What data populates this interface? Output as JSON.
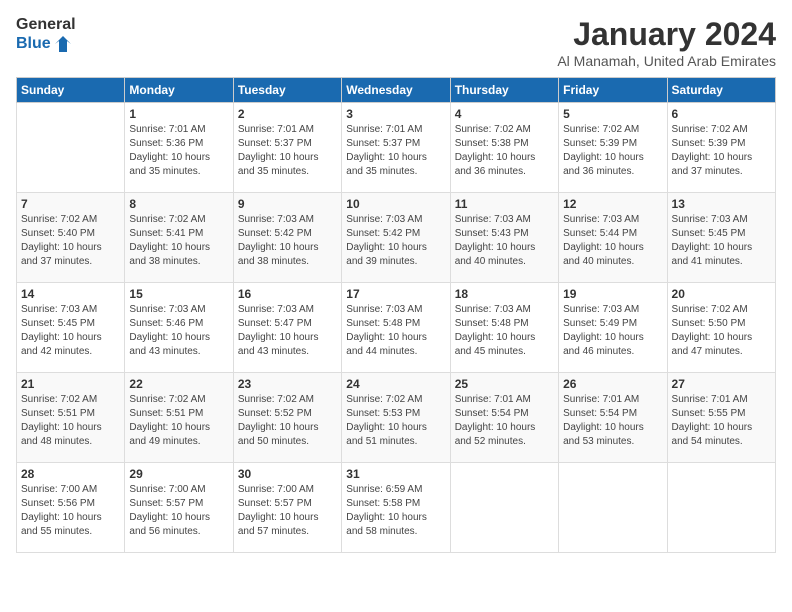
{
  "logo": {
    "line1": "General",
    "line2": "Blue"
  },
  "title": "January 2024",
  "subtitle": "Al Manamah, United Arab Emirates",
  "days_of_week": [
    "Sunday",
    "Monday",
    "Tuesday",
    "Wednesday",
    "Thursday",
    "Friday",
    "Saturday"
  ],
  "weeks": [
    [
      {
        "day": "",
        "sunrise": "",
        "sunset": "",
        "daylight": ""
      },
      {
        "day": "1",
        "sunrise": "Sunrise: 7:01 AM",
        "sunset": "Sunset: 5:36 PM",
        "daylight": "Daylight: 10 hours and 35 minutes."
      },
      {
        "day": "2",
        "sunrise": "Sunrise: 7:01 AM",
        "sunset": "Sunset: 5:37 PM",
        "daylight": "Daylight: 10 hours and 35 minutes."
      },
      {
        "day": "3",
        "sunrise": "Sunrise: 7:01 AM",
        "sunset": "Sunset: 5:37 PM",
        "daylight": "Daylight: 10 hours and 35 minutes."
      },
      {
        "day": "4",
        "sunrise": "Sunrise: 7:02 AM",
        "sunset": "Sunset: 5:38 PM",
        "daylight": "Daylight: 10 hours and 36 minutes."
      },
      {
        "day": "5",
        "sunrise": "Sunrise: 7:02 AM",
        "sunset": "Sunset: 5:39 PM",
        "daylight": "Daylight: 10 hours and 36 minutes."
      },
      {
        "day": "6",
        "sunrise": "Sunrise: 7:02 AM",
        "sunset": "Sunset: 5:39 PM",
        "daylight": "Daylight: 10 hours and 37 minutes."
      }
    ],
    [
      {
        "day": "7",
        "sunrise": "Sunrise: 7:02 AM",
        "sunset": "Sunset: 5:40 PM",
        "daylight": "Daylight: 10 hours and 37 minutes."
      },
      {
        "day": "8",
        "sunrise": "Sunrise: 7:02 AM",
        "sunset": "Sunset: 5:41 PM",
        "daylight": "Daylight: 10 hours and 38 minutes."
      },
      {
        "day": "9",
        "sunrise": "Sunrise: 7:03 AM",
        "sunset": "Sunset: 5:42 PM",
        "daylight": "Daylight: 10 hours and 38 minutes."
      },
      {
        "day": "10",
        "sunrise": "Sunrise: 7:03 AM",
        "sunset": "Sunset: 5:42 PM",
        "daylight": "Daylight: 10 hours and 39 minutes."
      },
      {
        "day": "11",
        "sunrise": "Sunrise: 7:03 AM",
        "sunset": "Sunset: 5:43 PM",
        "daylight": "Daylight: 10 hours and 40 minutes."
      },
      {
        "day": "12",
        "sunrise": "Sunrise: 7:03 AM",
        "sunset": "Sunset: 5:44 PM",
        "daylight": "Daylight: 10 hours and 40 minutes."
      },
      {
        "day": "13",
        "sunrise": "Sunrise: 7:03 AM",
        "sunset": "Sunset: 5:45 PM",
        "daylight": "Daylight: 10 hours and 41 minutes."
      }
    ],
    [
      {
        "day": "14",
        "sunrise": "Sunrise: 7:03 AM",
        "sunset": "Sunset: 5:45 PM",
        "daylight": "Daylight: 10 hours and 42 minutes."
      },
      {
        "day": "15",
        "sunrise": "Sunrise: 7:03 AM",
        "sunset": "Sunset: 5:46 PM",
        "daylight": "Daylight: 10 hours and 43 minutes."
      },
      {
        "day": "16",
        "sunrise": "Sunrise: 7:03 AM",
        "sunset": "Sunset: 5:47 PM",
        "daylight": "Daylight: 10 hours and 43 minutes."
      },
      {
        "day": "17",
        "sunrise": "Sunrise: 7:03 AM",
        "sunset": "Sunset: 5:48 PM",
        "daylight": "Daylight: 10 hours and 44 minutes."
      },
      {
        "day": "18",
        "sunrise": "Sunrise: 7:03 AM",
        "sunset": "Sunset: 5:48 PM",
        "daylight": "Daylight: 10 hours and 45 minutes."
      },
      {
        "day": "19",
        "sunrise": "Sunrise: 7:03 AM",
        "sunset": "Sunset: 5:49 PM",
        "daylight": "Daylight: 10 hours and 46 minutes."
      },
      {
        "day": "20",
        "sunrise": "Sunrise: 7:02 AM",
        "sunset": "Sunset: 5:50 PM",
        "daylight": "Daylight: 10 hours and 47 minutes."
      }
    ],
    [
      {
        "day": "21",
        "sunrise": "Sunrise: 7:02 AM",
        "sunset": "Sunset: 5:51 PM",
        "daylight": "Daylight: 10 hours and 48 minutes."
      },
      {
        "day": "22",
        "sunrise": "Sunrise: 7:02 AM",
        "sunset": "Sunset: 5:51 PM",
        "daylight": "Daylight: 10 hours and 49 minutes."
      },
      {
        "day": "23",
        "sunrise": "Sunrise: 7:02 AM",
        "sunset": "Sunset: 5:52 PM",
        "daylight": "Daylight: 10 hours and 50 minutes."
      },
      {
        "day": "24",
        "sunrise": "Sunrise: 7:02 AM",
        "sunset": "Sunset: 5:53 PM",
        "daylight": "Daylight: 10 hours and 51 minutes."
      },
      {
        "day": "25",
        "sunrise": "Sunrise: 7:01 AM",
        "sunset": "Sunset: 5:54 PM",
        "daylight": "Daylight: 10 hours and 52 minutes."
      },
      {
        "day": "26",
        "sunrise": "Sunrise: 7:01 AM",
        "sunset": "Sunset: 5:54 PM",
        "daylight": "Daylight: 10 hours and 53 minutes."
      },
      {
        "day": "27",
        "sunrise": "Sunrise: 7:01 AM",
        "sunset": "Sunset: 5:55 PM",
        "daylight": "Daylight: 10 hours and 54 minutes."
      }
    ],
    [
      {
        "day": "28",
        "sunrise": "Sunrise: 7:00 AM",
        "sunset": "Sunset: 5:56 PM",
        "daylight": "Daylight: 10 hours and 55 minutes."
      },
      {
        "day": "29",
        "sunrise": "Sunrise: 7:00 AM",
        "sunset": "Sunset: 5:57 PM",
        "daylight": "Daylight: 10 hours and 56 minutes."
      },
      {
        "day": "30",
        "sunrise": "Sunrise: 7:00 AM",
        "sunset": "Sunset: 5:57 PM",
        "daylight": "Daylight: 10 hours and 57 minutes."
      },
      {
        "day": "31",
        "sunrise": "Sunrise: 6:59 AM",
        "sunset": "Sunset: 5:58 PM",
        "daylight": "Daylight: 10 hours and 58 minutes."
      },
      {
        "day": "",
        "sunrise": "",
        "sunset": "",
        "daylight": ""
      },
      {
        "day": "",
        "sunrise": "",
        "sunset": "",
        "daylight": ""
      },
      {
        "day": "",
        "sunrise": "",
        "sunset": "",
        "daylight": ""
      }
    ]
  ],
  "accent_color": "#1a6ab0"
}
